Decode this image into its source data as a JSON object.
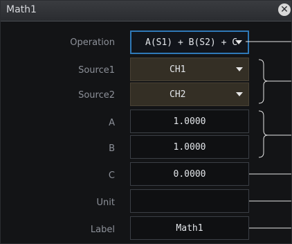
{
  "window": {
    "title": "Math1",
    "close_icon": "close-icon"
  },
  "fields": {
    "operation": {
      "label": "Operation",
      "value": "A(S1) + B(S2) + C",
      "type": "dropdown"
    },
    "source1": {
      "label": "Source1",
      "value": "CH1",
      "type": "dropdown"
    },
    "source2": {
      "label": "Source2",
      "value": "CH2",
      "type": "dropdown"
    },
    "a": {
      "label": "A",
      "value": "1.0000"
    },
    "b": {
      "label": "B",
      "value": "1.0000"
    },
    "c": {
      "label": "C",
      "value": "0.0000"
    },
    "unit": {
      "label": "Unit",
      "value": ""
    },
    "label": {
      "label": "Label",
      "value": "Math1"
    }
  },
  "colors": {
    "accent_blue": "#2f79b8",
    "dropdown_bg": "#342f25",
    "window_bg": "#131416"
  }
}
